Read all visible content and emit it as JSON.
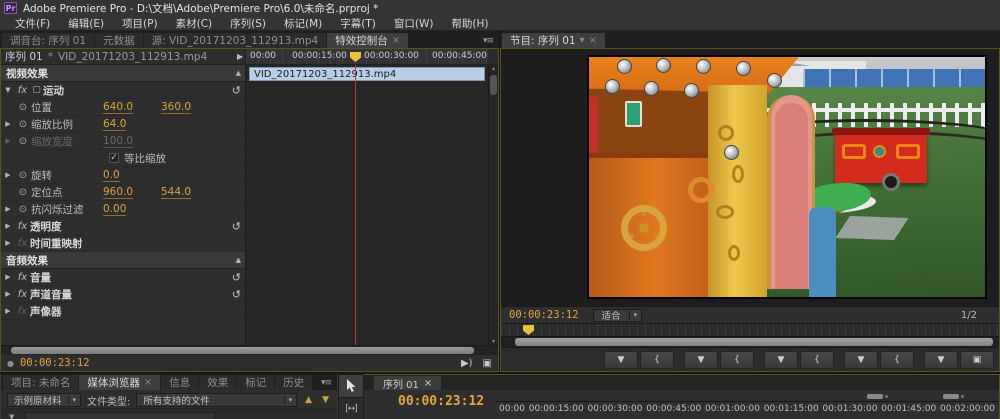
{
  "icons": {
    "pr-logo": "Pr",
    "close": "×",
    "panel-menu": "▾≡",
    "twirl-open": "▼",
    "twirl-closed": "▶",
    "collapse": "▲",
    "fx": "fx",
    "stopwatch": "⊙",
    "reset": "↺",
    "check": "✓",
    "motion-box": "▢",
    "header-arrow": "▶",
    "dropdown": "▾",
    "up-arrow": "▲",
    "down-arrow": "▼",
    "marker": "▼",
    "brace": "{",
    "export-frame": "▣",
    "play-audio": "▶)",
    "loop-toggle": "▣",
    "track-select": "[↔]",
    "scroll-up": "▴",
    "scroll-down": "▾",
    "record-dot": "●",
    "tab-dd": "▾"
  },
  "title_bar": {
    "app_title": "Adobe Premiere Pro - D:\\文档\\Adobe\\Premiere Pro\\6.0\\未命名.prproj *"
  },
  "menu": {
    "items": [
      "文件(F)",
      "编辑(E)",
      "项目(P)",
      "素材(C)",
      "序列(S)",
      "标记(M)",
      "字幕(T)",
      "窗口(W)",
      "帮助(H)"
    ]
  },
  "left_panel": {
    "tabs": [
      "调音台: 序列 01",
      "元数据",
      "源: VID_20171203_112913.mp4",
      "特效控制台"
    ]
  },
  "effect_controls": {
    "sequence_name": "序列 01",
    "star": "*",
    "clip_name": "VID_20171203_112913.mp4",
    "ruler": [
      "00:00",
      "00:00:15:00",
      "00:00:30:00",
      "00:00:45:00"
    ],
    "clip_bar": "VID_20171203_112913.mp4",
    "video_section": "视频效果",
    "audio_section": "音频效果",
    "motion": "运动",
    "position": {
      "label": "位置",
      "x": "640.0",
      "y": "360.0"
    },
    "scale": {
      "label": "缩放比例",
      "value": "64.0"
    },
    "scale_width": {
      "label": "缩放宽度",
      "value": "100.0"
    },
    "uniform_scale": "等比缩放",
    "rotation": {
      "label": "旋转",
      "value": "0.0"
    },
    "anchor": {
      "label": "定位点",
      "x": "960.0",
      "y": "544.0"
    },
    "antiflicker": {
      "label": "抗闪烁过滤",
      "value": "0.00"
    },
    "opacity": "透明度",
    "time_remap": "时间重映射",
    "volume": "音量",
    "channel_volume": "声道音量",
    "panner": "声像器",
    "timecode": "00:00:23:12"
  },
  "program_monitor": {
    "tab": "节目: 序列 01",
    "timecode": "00:00:23:12",
    "zoom_level": "适合",
    "page_indicator": "1/2"
  },
  "media_browser": {
    "tabs": [
      "项目: 未命名",
      "媒体浏览器",
      "信息",
      "效果",
      "标记",
      "历史"
    ],
    "source": "示例原材料",
    "file_type_label": "文件类型:",
    "file_type_value": "所有支持的文件"
  },
  "timeline": {
    "tab": "序列 01",
    "timecode": "00:00:23:12",
    "ruler": [
      "00:00",
      "00:00:15:00",
      "00:00:30:00",
      "00:00:45:00",
      "00:01:00:00",
      "00:01:15:00",
      "00:01:30:00",
      "00:01:45:00",
      "00:02:00:00"
    ]
  },
  "colors": {
    "accent_orange": "#e8a33d",
    "clip_blue": "#b9cfe8",
    "playhead_yellow": "#e8c23d",
    "red_line": "#c03434"
  }
}
